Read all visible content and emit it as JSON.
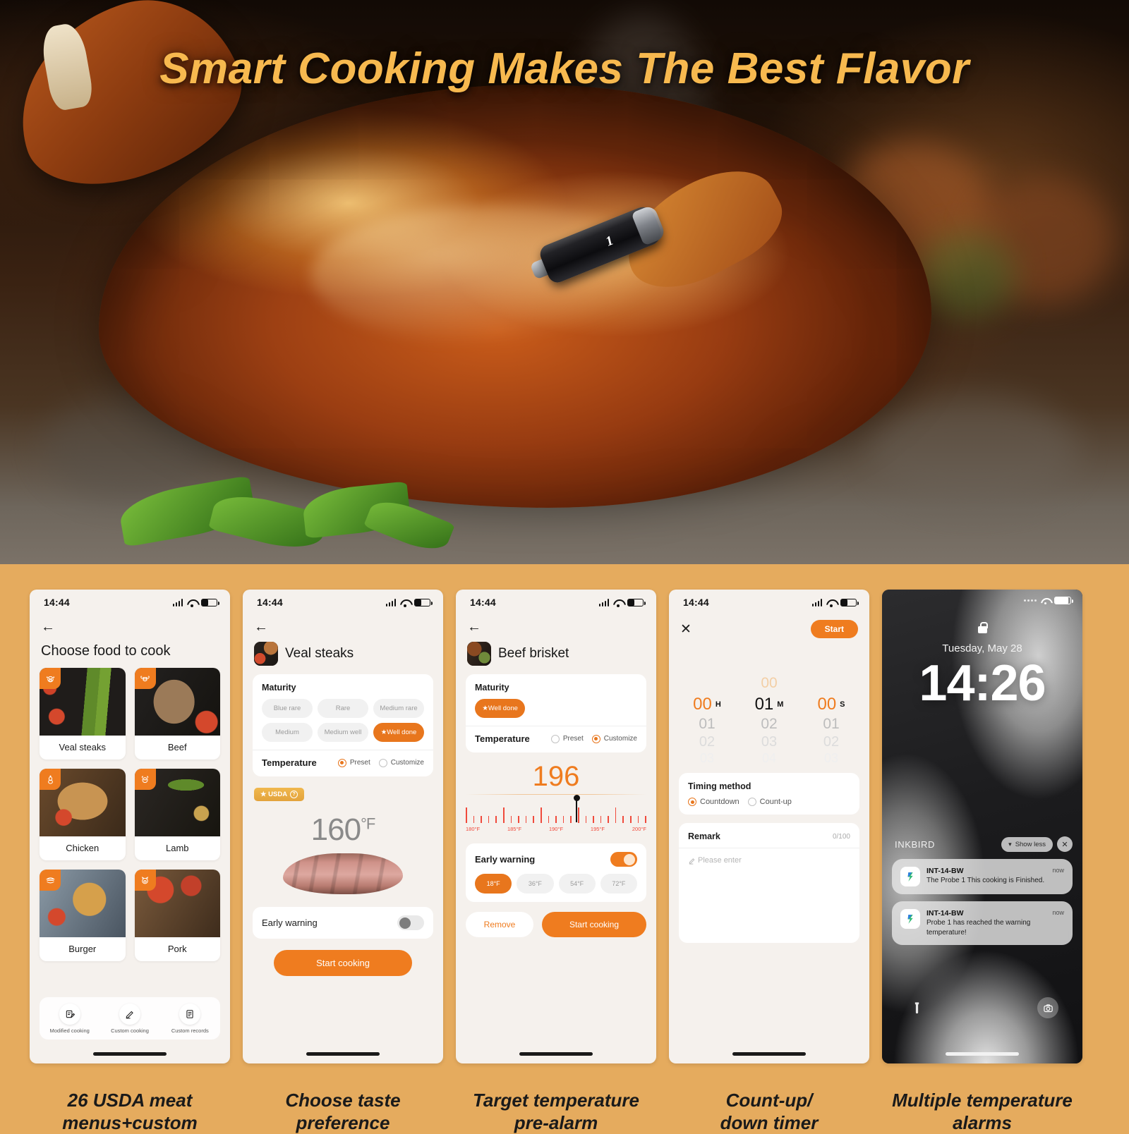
{
  "hero": {
    "headline": "Smart Cooking Makes The Best Flavor",
    "probe_label": "1"
  },
  "screens": [
    {
      "id": "choose-food",
      "status": {
        "time": "14:44"
      },
      "nav": {
        "back": "←"
      },
      "title": "Choose food to cook",
      "foods": [
        {
          "name": "Veal steaks",
          "icon": "cow-face-icon"
        },
        {
          "name": "Beef",
          "icon": "bull-icon"
        },
        {
          "name": "Chicken",
          "icon": "chicken-icon"
        },
        {
          "name": "Lamb",
          "icon": "lamb-icon"
        },
        {
          "name": "Burger",
          "icon": "burger-icon"
        },
        {
          "name": "Pork",
          "icon": "pig-icon"
        }
      ],
      "tabbar": [
        {
          "label": "Modified cooking",
          "icon": "edit-list-icon"
        },
        {
          "label": "Custom cooking",
          "icon": "pencil-icon"
        },
        {
          "label": "Custom records",
          "icon": "document-icon"
        }
      ],
      "caption_line1": "26 USDA meat",
      "caption_line2": "menus+custom"
    },
    {
      "id": "veal-steaks-preset",
      "status": {
        "time": "14:44"
      },
      "food_title": "Veal steaks",
      "maturity_label": "Maturity",
      "maturity_options": [
        "Blue rare",
        "Rare",
        "Medium rare",
        "Medium",
        "Medium well",
        "★Well done"
      ],
      "maturity_selected": "★Well done",
      "temperature_label": "Temperature",
      "temp_modes": [
        "Preset",
        "Customize"
      ],
      "temp_mode_selected": "Preset",
      "usda_badge": "★ USDA",
      "usda_help": "?",
      "temperature_value": "160",
      "temperature_unit": "°F",
      "early_warning_label": "Early warning",
      "early_warning_on": false,
      "cta": "Start cooking",
      "caption_line1": "Choose taste",
      "caption_line2": "preference"
    },
    {
      "id": "beef-brisket-customize",
      "status": {
        "time": "14:44"
      },
      "food_title": "Beef brisket",
      "maturity_label": "Maturity",
      "maturity_selected": "★Well done",
      "temperature_label": "Temperature",
      "temp_modes": [
        "Preset",
        "Customize"
      ],
      "temp_mode_selected": "Customize",
      "target_value": "196",
      "scale_labels": [
        "180°F",
        "185°F",
        "190°F",
        "195°F",
        "200°F"
      ],
      "early_warning_label": "Early warning",
      "early_warning_on": true,
      "warning_offsets": [
        "18°F",
        "36°F",
        "54°F",
        "72°F"
      ],
      "warning_selected": "18°F",
      "remove_label": "Remove",
      "cta": "Start cooking",
      "caption_line1": "Target temperature",
      "caption_line2": "pre-alarm"
    },
    {
      "id": "timer",
      "status": {
        "time": "14:44"
      },
      "close": "✕",
      "start_label": "Start",
      "wheels": [
        {
          "unit": "H",
          "prev": "",
          "current": "00",
          "next": "01",
          "next2": "02"
        },
        {
          "unit": "M",
          "prev": "00",
          "current": "01",
          "next": "02",
          "next2": "03"
        },
        {
          "unit": "S",
          "prev": "",
          "current": "00",
          "next": "01",
          "next2": "02"
        }
      ],
      "timing_method_label": "Timing method",
      "timing_options": [
        "Countdown",
        "Count-up"
      ],
      "timing_selected": "Countdown",
      "remark_label": "Remark",
      "remark_count": "0/100",
      "remark_placeholder": "Please enter",
      "caption_line1": "Count-up/",
      "caption_line2": "down timer"
    },
    {
      "id": "lock-screen",
      "date": "Tuesday, May 28",
      "time": "14:26",
      "notif_group": "INKBIRD",
      "show_less": "Show less",
      "close": "✕",
      "notifications": [
        {
          "app": "INT-14-BW",
          "text": "The Probe 1 This cooking is Finished.",
          "time": "now"
        },
        {
          "app": "INT-14-BW",
          "text": "Probe 1 has reached the warning temperature!",
          "time": "now"
        }
      ],
      "torch_icon": "flashlight-icon",
      "camera_icon": "camera-icon",
      "caption_line1": "Multiple temperature",
      "caption_line2": "alarms"
    }
  ],
  "colors": {
    "background": "#e5ab5e",
    "accent": "#ef7c1f",
    "headline": "#f7b94f",
    "scale": "#f04a3c",
    "usda": "#e3a33c"
  }
}
